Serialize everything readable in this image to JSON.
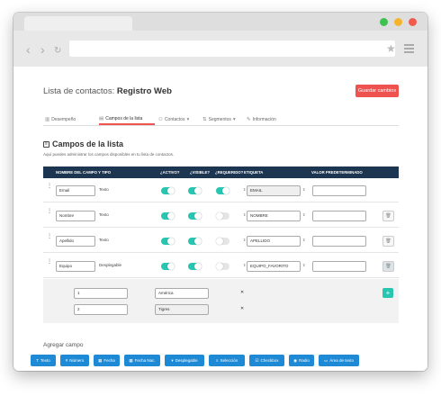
{
  "header": {
    "title_prefix": "Lista de contactos: ",
    "title_name": "Registro Web",
    "save_label": "Guardar cambios"
  },
  "tabs": [
    {
      "label": "Desempeño",
      "icon": "chart-icon"
    },
    {
      "label": "Campos de la lista",
      "icon": "fields-icon"
    },
    {
      "label": "Contactos",
      "icon": "users-icon"
    },
    {
      "label": "Segmentos",
      "icon": "segments-icon"
    },
    {
      "label": "Información",
      "icon": "edit-icon"
    }
  ],
  "section": {
    "title": "Campos de la lista",
    "description": "Aquí puedes administrar los campos disponibles en tu lista de contactos."
  },
  "table": {
    "columns": [
      "NOMBRE DEL CAMPO Y TIPO",
      "¿ACTIVO?",
      "¿VISIBLE?",
      "¿REQUERIDO?",
      "ETIQUETA",
      "VALOR PREDETERMINADO"
    ],
    "rows": [
      {
        "name": "Email",
        "type": "Texto",
        "activo": true,
        "visible": true,
        "requerido": true,
        "etiqueta": "EMAIL",
        "valor": ""
      },
      {
        "name": "Nombre",
        "type": "Texto",
        "activo": true,
        "visible": true,
        "requerido": false,
        "etiqueta": "NOMBRE",
        "valor": ""
      },
      {
        "name": "Apellido",
        "type": "Texto",
        "activo": true,
        "visible": true,
        "requerido": false,
        "etiqueta": "APELLIDO",
        "valor": ""
      },
      {
        "name": "Equipo",
        "type": "Desplegable",
        "activo": true,
        "visible": true,
        "requerido": false,
        "etiqueta": "EQUIPO_FAVORITO",
        "valor": ""
      }
    ],
    "options": [
      {
        "value": "1",
        "label": "América"
      },
      {
        "value": "2",
        "label": "Tigres"
      }
    ]
  },
  "add_field": {
    "title": "Agregar campo",
    "buttons": [
      "Texto",
      "Número",
      "Fecha",
      "Fecha Nac.",
      "Desplegable",
      "Selección",
      "Checkbox",
      "Radio",
      "Área de texto"
    ]
  },
  "colors": {
    "accent": "#ef5350",
    "toggle_on": "#26c6b0",
    "header_bg": "#1c3550",
    "button_blue": "#1e8ad6"
  }
}
